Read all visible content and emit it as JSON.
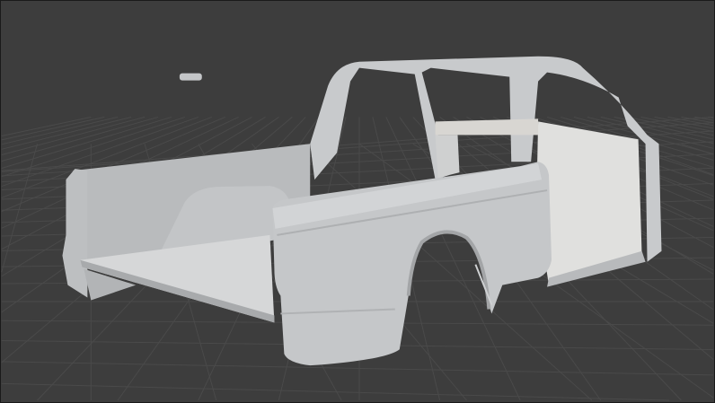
{
  "viewport": {
    "background_color": "#3d3d3d",
    "grid_color": "#4a4a4a",
    "model_color": "#c9cbcd",
    "model_shadow_color": "#a9abad",
    "model_highlight_color": "#dcdddf",
    "interior_color": "#e2e2e0"
  }
}
